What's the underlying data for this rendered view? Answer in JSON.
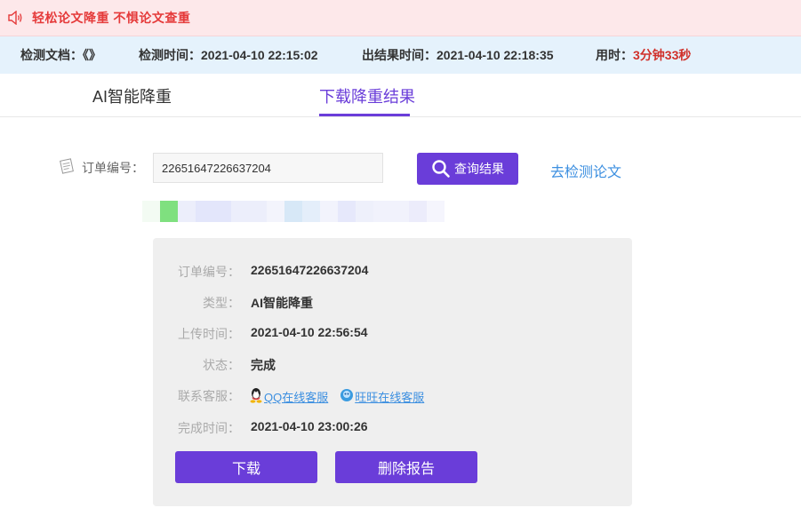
{
  "banner": {
    "text": "轻松论文降重 不惧论文查重",
    "icon": "speaker-icon"
  },
  "infobar": {
    "doc_label": "检测文档：《》",
    "detect_time_label": "检测时间：",
    "detect_time": "2021-04-10 22:15:02",
    "result_time_label": "出结果时间：",
    "result_time": "2021-04-10 22:18:35",
    "duration_label": "用时：",
    "duration": "3分钟33秒"
  },
  "tabs": [
    {
      "label": "AI智能降重",
      "active": false
    },
    {
      "label": "下载降重结果",
      "active": true
    }
  ],
  "query": {
    "label": "订单编号：",
    "order_value": "22651647226637204",
    "button_label": "查询结果",
    "detect_link": "去检测论文"
  },
  "details": {
    "order_label": "订单编号：",
    "order_value": "22651647226637204",
    "type_label": "类型：",
    "type_value": "AI智能降重",
    "upload_label": "上传时间：",
    "upload_value": "2021-04-10 22:56:54",
    "status_label": "状态：",
    "status_value": "完成",
    "contact_label": "联系客服：",
    "qq_link": "QQ在线客服",
    "wangwang_link": "旺旺在线客服",
    "finish_label": "完成时间：",
    "finish_value": "2021-04-10 23:00:26"
  },
  "actions": {
    "download": "下载",
    "delete": "删除报告"
  },
  "colors": {
    "accent": "#6a3dd9",
    "link": "#3c8fe0",
    "alert": "#e53a3a",
    "banner_bg": "#fde8ea",
    "info_bg": "#e5f2fc"
  }
}
